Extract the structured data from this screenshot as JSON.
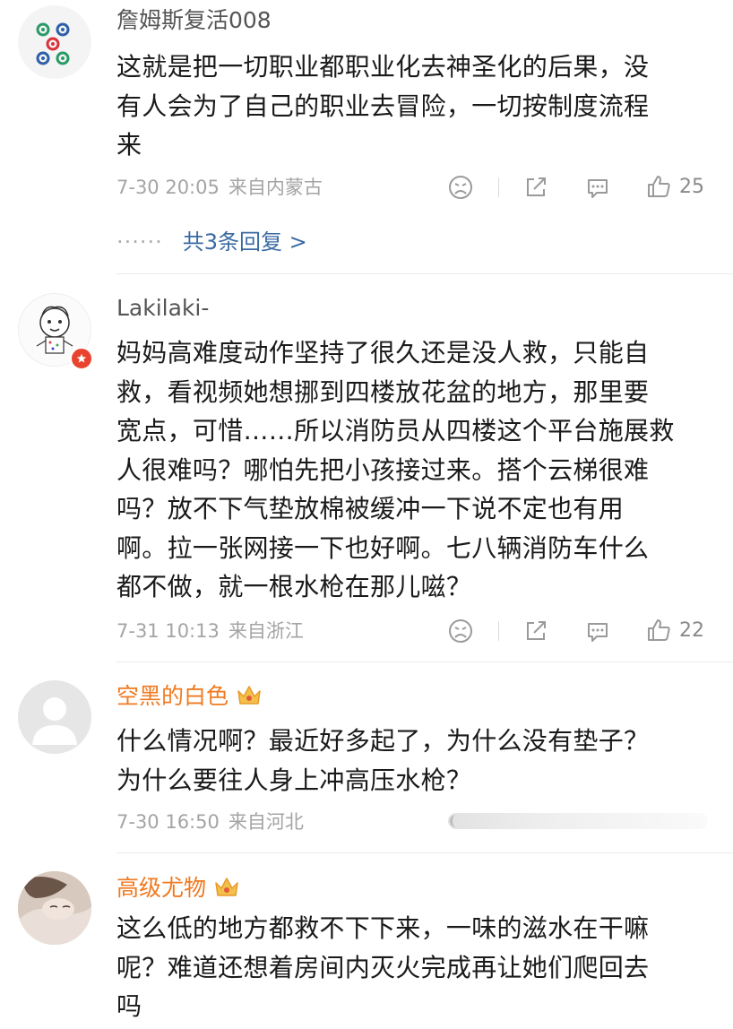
{
  "comments": [
    {
      "username": "詹姆斯复活008",
      "text_lines": [
        "这就是把一切职业都职业化去神圣化的后果，没",
        "有人会为了自己的职业去冒险，一切按制度流程",
        "来"
      ],
      "time": "7-30 20:05",
      "location": "来自内蒙古",
      "likes": "25",
      "replies_dots": "······",
      "replies_label": "共3条回复 >",
      "avatar_icon": "grid-dots-avatar"
    },
    {
      "username": "Lakilaki-",
      "text_lines": [
        "妈妈高难度动作坚持了很久还是没人救，只能自",
        "救，看视频她想挪到四楼放花盆的地方，那里要",
        "宽点，可惜……所以消防员从四楼这个平台施展救",
        "人很难吗？哪怕先把小孩接过来。搭个云梯很难",
        "吗？放不下气垫放棉被缓冲一下说不定也有用",
        "啊。拉一张网接一下也好啊。七八辆消防车什么",
        "都不做，就一根水枪在那儿嗞？"
      ],
      "time": "7-31 10:13",
      "location": "来自浙江",
      "likes": "22",
      "avatar_icon": "cartoon-child-avatar",
      "badge_icon": "verified-star-badge"
    },
    {
      "username": "空黑的白色",
      "text_lines": [
        "什么情况啊？最近好多起了，为什么没有垫子？",
        "为什么要往人身上冲高压水枪？"
      ],
      "time": "7-30 16:50",
      "location": "来自河北",
      "avatar_icon": "default-gray-avatar",
      "crown_icon": "vip-crown-icon"
    },
    {
      "username": "高级尤物",
      "text_lines": [
        "这么低的地方都救不下下来，一味的滋水在干嘛",
        "呢？难道还想着房间内灭火完成再让她们爬回去",
        "吗"
      ],
      "avatar_icon": "photo-avatar",
      "crown_icon": "vip-crown-icon"
    }
  ],
  "colors": {
    "vip_name": "#ef7a22",
    "replies_link": "#3a6aa3",
    "meta_gray": "#a4a4a4",
    "badge_red": "#e8432f"
  }
}
